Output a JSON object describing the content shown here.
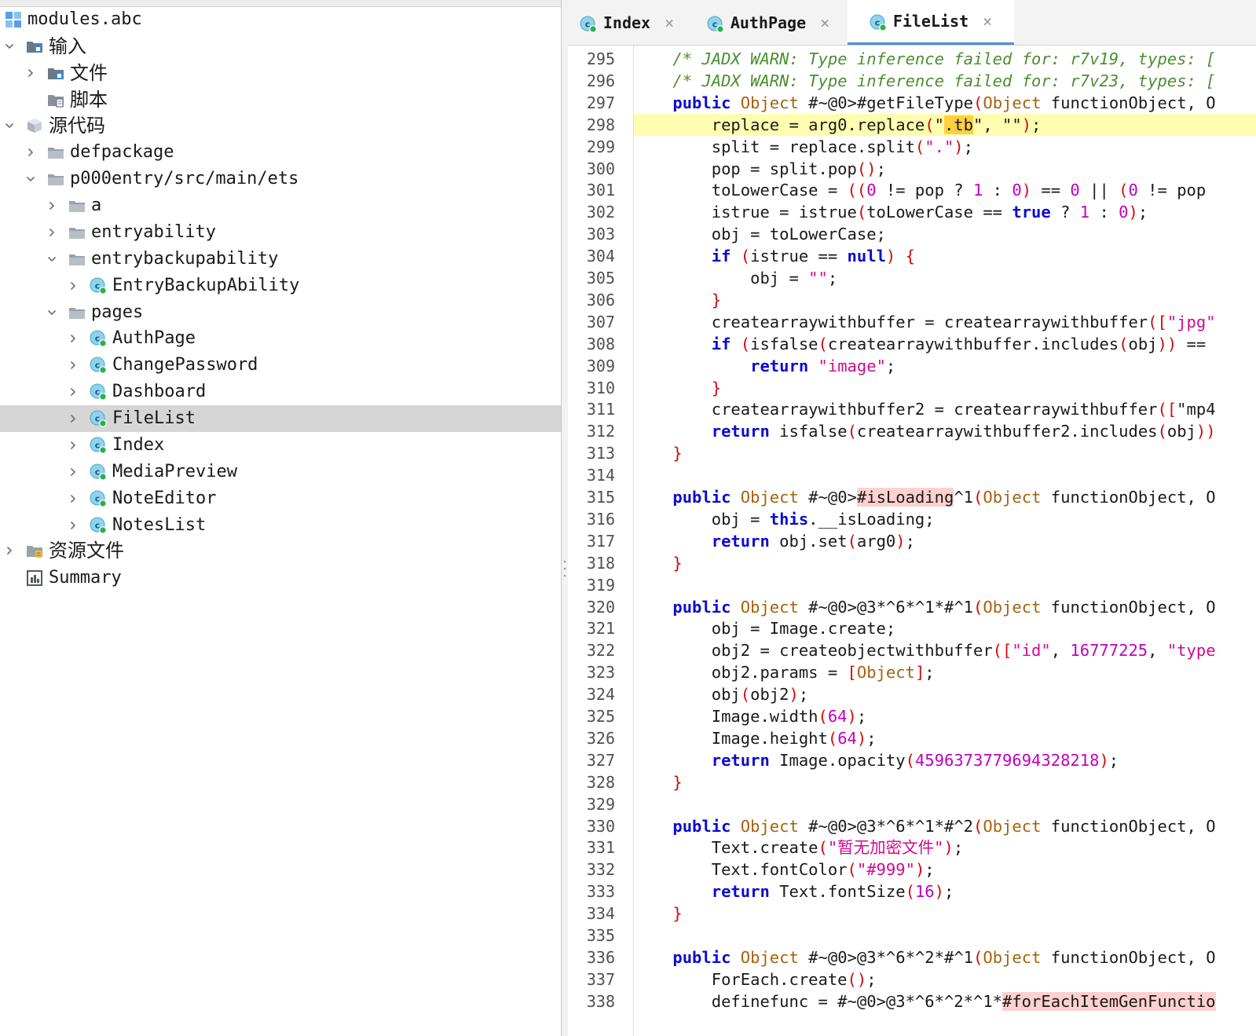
{
  "tree": {
    "items": [
      {
        "label": "modules.abc",
        "icon": "modules-icon",
        "level": 0,
        "chevron": "none",
        "cjk": false
      },
      {
        "label": "输入",
        "icon": "input-folder-icon",
        "level": 0,
        "chevron": "down",
        "cjk": true
      },
      {
        "label": "文件",
        "icon": "input-folder-icon",
        "level": 1,
        "chevron": "right",
        "cjk": true
      },
      {
        "label": "脚本",
        "icon": "script-folder-icon",
        "level": 1,
        "chevron": "none",
        "cjk": true
      },
      {
        "label": "源代码",
        "icon": "package-icon",
        "level": 0,
        "chevron": "down",
        "cjk": true
      },
      {
        "label": "defpackage",
        "icon": "folder-icon",
        "level": 1,
        "chevron": "right",
        "cjk": false
      },
      {
        "label": "p000entry/src/main/ets",
        "icon": "folder-icon",
        "level": 1,
        "chevron": "down",
        "cjk": false
      },
      {
        "label": "a",
        "icon": "folder-icon",
        "level": 2,
        "chevron": "right",
        "cjk": false
      },
      {
        "label": "entryability",
        "icon": "folder-icon",
        "level": 2,
        "chevron": "right",
        "cjk": false
      },
      {
        "label": "entrybackupability",
        "icon": "folder-icon",
        "level": 2,
        "chevron": "down",
        "cjk": false
      },
      {
        "label": "EntryBackupAbility",
        "icon": "class-icon",
        "level": 3,
        "chevron": "right",
        "cjk": false
      },
      {
        "label": "pages",
        "icon": "folder-icon",
        "level": 2,
        "chevron": "down",
        "cjk": false
      },
      {
        "label": "AuthPage",
        "icon": "class-icon",
        "level": 3,
        "chevron": "right",
        "cjk": false
      },
      {
        "label": "ChangePassword",
        "icon": "class-icon",
        "level": 3,
        "chevron": "right",
        "cjk": false
      },
      {
        "label": "Dashboard",
        "icon": "class-icon",
        "level": 3,
        "chevron": "right",
        "cjk": false
      },
      {
        "label": "FileList",
        "icon": "class-icon",
        "level": 3,
        "chevron": "right",
        "cjk": false,
        "selected": true
      },
      {
        "label": "Index",
        "icon": "class-icon",
        "level": 3,
        "chevron": "right",
        "cjk": false
      },
      {
        "label": "MediaPreview",
        "icon": "class-icon",
        "level": 3,
        "chevron": "right",
        "cjk": false
      },
      {
        "label": "NoteEditor",
        "icon": "class-icon",
        "level": 3,
        "chevron": "right",
        "cjk": false
      },
      {
        "label": "NotesList",
        "icon": "class-icon",
        "level": 3,
        "chevron": "right",
        "cjk": false
      },
      {
        "label": "资源文件",
        "icon": "resources-folder-icon",
        "level": 0,
        "chevron": "right",
        "cjk": true
      },
      {
        "label": "Summary",
        "icon": "summary-icon",
        "level": 0,
        "chevron": "none",
        "cjk": false
      }
    ]
  },
  "tabs": [
    {
      "label": "Index",
      "active": false
    },
    {
      "label": "AuthPage",
      "active": false
    },
    {
      "label": "FileList",
      "active": true
    }
  ],
  "tab_close_glyph": "×",
  "editor": {
    "highlight_line": 298,
    "lines": [
      {
        "n": 295,
        "tokens": [
          [
            "    ",
            ""
          ],
          [
            "/* JADX WARN: Type inference failed for: r7v19, types: [",
            ""
          ]
        ],
        "comment": true
      },
      {
        "n": 296,
        "tokens": [
          [
            "    ",
            ""
          ],
          [
            "/* JADX WARN: Type inference failed for: r7v23, types: [",
            ""
          ]
        ],
        "comment": true
      },
      {
        "n": 297,
        "tokens": [
          [
            "    ",
            ""
          ],
          [
            "public",
            "k"
          ],
          [
            " ",
            ""
          ],
          [
            "Object",
            "t"
          ],
          [
            " #~@0>#getFileType",
            ""
          ],
          [
            "(",
            "p"
          ],
          [
            "Object",
            "t"
          ],
          [
            " functionObject, O",
            ""
          ]
        ]
      },
      {
        "n": 298,
        "tokens": [
          [
            "        replace = arg0.replace",
            ""
          ],
          [
            "(",
            "p"
          ],
          [
            "\"",
            ""
          ],
          [
            ".tb",
            "hy"
          ],
          [
            "\"",
            ""
          ],
          [
            ", \"\"",
            ""
          ],
          [
            ")",
            "p"
          ],
          [
            ";",
            ""
          ]
        ]
      },
      {
        "n": 299,
        "tokens": [
          [
            "        split = replace.split",
            ""
          ],
          [
            "(",
            "p"
          ],
          [
            "\".\"",
            "s"
          ],
          [
            ")",
            "p"
          ],
          [
            ";",
            ""
          ]
        ]
      },
      {
        "n": 300,
        "tokens": [
          [
            "        pop = split.pop",
            ""
          ],
          [
            "()",
            "p"
          ],
          [
            ";",
            ""
          ]
        ]
      },
      {
        "n": 301,
        "tokens": [
          [
            "        toLowerCase = ",
            ""
          ],
          [
            "((",
            "p"
          ],
          [
            "0",
            "n"
          ],
          [
            " != pop ? ",
            ""
          ],
          [
            "1",
            "n"
          ],
          [
            " : ",
            ""
          ],
          [
            "0",
            "n"
          ],
          [
            ")",
            "p"
          ],
          [
            " == ",
            ""
          ],
          [
            "0",
            "n"
          ],
          [
            " || ",
            ""
          ],
          [
            "(",
            "p"
          ],
          [
            "0",
            "n"
          ],
          [
            " != pop",
            ""
          ]
        ]
      },
      {
        "n": 302,
        "tokens": [
          [
            "        istrue = istrue",
            ""
          ],
          [
            "(",
            "p"
          ],
          [
            "toLowerCase == ",
            ""
          ],
          [
            "true",
            "k"
          ],
          [
            " ? ",
            ""
          ],
          [
            "1",
            "n"
          ],
          [
            " : ",
            ""
          ],
          [
            "0",
            "n"
          ],
          [
            ")",
            "p"
          ],
          [
            ";",
            ""
          ]
        ]
      },
      {
        "n": 303,
        "tokens": [
          [
            "        obj = toLowerCase;",
            ""
          ]
        ]
      },
      {
        "n": 304,
        "tokens": [
          [
            "        ",
            ""
          ],
          [
            "if",
            "k"
          ],
          [
            " ",
            ""
          ],
          [
            "(",
            "p"
          ],
          [
            "istrue == ",
            ""
          ],
          [
            "null",
            "k"
          ],
          [
            ")",
            "p"
          ],
          [
            " ",
            ""
          ],
          [
            "{",
            "p"
          ]
        ]
      },
      {
        "n": 305,
        "tokens": [
          [
            "            obj = ",
            ""
          ],
          [
            "\"\"",
            "s"
          ],
          [
            ";",
            ""
          ]
        ]
      },
      {
        "n": 306,
        "tokens": [
          [
            "        ",
            ""
          ],
          [
            "}",
            "p"
          ]
        ]
      },
      {
        "n": 307,
        "tokens": [
          [
            "        createarraywithbuffer = createarraywithbuffer",
            ""
          ],
          [
            "([",
            "p"
          ],
          [
            "\"jpg\"",
            "s"
          ]
        ]
      },
      {
        "n": 308,
        "tokens": [
          [
            "        ",
            ""
          ],
          [
            "if",
            "k"
          ],
          [
            " ",
            ""
          ],
          [
            "(",
            "p"
          ],
          [
            "isfalse",
            ""
          ],
          [
            "(",
            "p"
          ],
          [
            "createarraywithbuffer.includes",
            ""
          ],
          [
            "(",
            "p"
          ],
          [
            "obj",
            ""
          ],
          [
            "))",
            "p"
          ],
          [
            " ==",
            ""
          ]
        ]
      },
      {
        "n": 309,
        "tokens": [
          [
            "            ",
            ""
          ],
          [
            "return",
            "k"
          ],
          [
            " ",
            ""
          ],
          [
            "\"image\"",
            "s"
          ],
          [
            ";",
            ""
          ]
        ]
      },
      {
        "n": 310,
        "tokens": [
          [
            "        ",
            ""
          ],
          [
            "}",
            "p"
          ]
        ]
      },
      {
        "n": 311,
        "tokens": [
          [
            "        createarraywithbuffer2 = createarraywithbuffer",
            ""
          ],
          [
            "([",
            "p"
          ],
          [
            "\"mp4",
            ""
          ]
        ]
      },
      {
        "n": 312,
        "tokens": [
          [
            "        ",
            ""
          ],
          [
            "return",
            "k"
          ],
          [
            " isfalse",
            ""
          ],
          [
            "(",
            "p"
          ],
          [
            "createarraywithbuffer2.includes",
            ""
          ],
          [
            "(",
            "p"
          ],
          [
            "obj",
            ""
          ],
          [
            "))",
            "p"
          ]
        ]
      },
      {
        "n": 313,
        "tokens": [
          [
            "    ",
            ""
          ],
          [
            "}",
            "p"
          ]
        ]
      },
      {
        "n": 314,
        "tokens": [
          [
            "",
            ""
          ]
        ]
      },
      {
        "n": 315,
        "tokens": [
          [
            "    ",
            ""
          ],
          [
            "public",
            "k"
          ],
          [
            " ",
            ""
          ],
          [
            "Object",
            "t"
          ],
          [
            " #~@0>",
            ""
          ],
          [
            "#isLoading",
            "hp"
          ],
          [
            "^1",
            ""
          ],
          [
            "(",
            "p"
          ],
          [
            "Object",
            "t"
          ],
          [
            " functionObject, O",
            ""
          ]
        ]
      },
      {
        "n": 316,
        "tokens": [
          [
            "        obj = ",
            ""
          ],
          [
            "this",
            "k"
          ],
          [
            ".__isLoading;",
            ""
          ]
        ]
      },
      {
        "n": 317,
        "tokens": [
          [
            "        ",
            ""
          ],
          [
            "return",
            "k"
          ],
          [
            " obj.set",
            ""
          ],
          [
            "(",
            "p"
          ],
          [
            "arg0",
            ""
          ],
          [
            ")",
            "p"
          ],
          [
            ";",
            ""
          ]
        ]
      },
      {
        "n": 318,
        "tokens": [
          [
            "    ",
            ""
          ],
          [
            "}",
            "p"
          ]
        ]
      },
      {
        "n": 319,
        "tokens": [
          [
            "",
            ""
          ]
        ]
      },
      {
        "n": 320,
        "tokens": [
          [
            "    ",
            ""
          ],
          [
            "public",
            "k"
          ],
          [
            " ",
            ""
          ],
          [
            "Object",
            "t"
          ],
          [
            " #~@0>@3*^6*^1*#^1",
            ""
          ],
          [
            "(",
            "p"
          ],
          [
            "Object",
            "t"
          ],
          [
            " functionObject, O",
            ""
          ]
        ]
      },
      {
        "n": 321,
        "tokens": [
          [
            "        obj = Image.create;",
            ""
          ]
        ]
      },
      {
        "n": 322,
        "tokens": [
          [
            "        obj2 = createobjectwithbuffer",
            ""
          ],
          [
            "([",
            "p"
          ],
          [
            "\"id\"",
            "s"
          ],
          [
            ", ",
            ""
          ],
          [
            "16777225",
            "n"
          ],
          [
            ", ",
            ""
          ],
          [
            "\"type",
            "s"
          ]
        ]
      },
      {
        "n": 323,
        "tokens": [
          [
            "        obj2.params = ",
            ""
          ],
          [
            "[",
            "p"
          ],
          [
            "Object",
            "t"
          ],
          [
            "]",
            "p"
          ],
          [
            ";",
            ""
          ]
        ]
      },
      {
        "n": 324,
        "tokens": [
          [
            "        obj",
            ""
          ],
          [
            "(",
            "p"
          ],
          [
            "obj2",
            ""
          ],
          [
            ")",
            "p"
          ],
          [
            ";",
            ""
          ]
        ]
      },
      {
        "n": 325,
        "tokens": [
          [
            "        Image.width",
            ""
          ],
          [
            "(",
            "p"
          ],
          [
            "64",
            "n"
          ],
          [
            ")",
            "p"
          ],
          [
            ";",
            ""
          ]
        ]
      },
      {
        "n": 326,
        "tokens": [
          [
            "        Image.height",
            ""
          ],
          [
            "(",
            "p"
          ],
          [
            "64",
            "n"
          ],
          [
            ")",
            "p"
          ],
          [
            ";",
            ""
          ]
        ]
      },
      {
        "n": 327,
        "tokens": [
          [
            "        ",
            ""
          ],
          [
            "return",
            "k"
          ],
          [
            " Image.opacity",
            ""
          ],
          [
            "(",
            "p"
          ],
          [
            "4596373779694328218",
            "n"
          ],
          [
            ")",
            "p"
          ],
          [
            ";",
            ""
          ]
        ]
      },
      {
        "n": 328,
        "tokens": [
          [
            "    ",
            ""
          ],
          [
            "}",
            "p"
          ]
        ]
      },
      {
        "n": 329,
        "tokens": [
          [
            "",
            ""
          ]
        ]
      },
      {
        "n": 330,
        "tokens": [
          [
            "    ",
            ""
          ],
          [
            "public",
            "k"
          ],
          [
            " ",
            ""
          ],
          [
            "Object",
            "t"
          ],
          [
            " #~@0>@3*^6*^1*#^2",
            ""
          ],
          [
            "(",
            "p"
          ],
          [
            "Object",
            "t"
          ],
          [
            " functionObject, O",
            ""
          ]
        ]
      },
      {
        "n": 331,
        "tokens": [
          [
            "        Text.create",
            ""
          ],
          [
            "(",
            "p"
          ],
          [
            "\"暂无加密文件\"",
            "s"
          ],
          [
            ")",
            "p"
          ],
          [
            ";",
            ""
          ]
        ]
      },
      {
        "n": 332,
        "tokens": [
          [
            "        Text.fontColor",
            ""
          ],
          [
            "(",
            "p"
          ],
          [
            "\"#999\"",
            "s"
          ],
          [
            ")",
            "p"
          ],
          [
            ";",
            ""
          ]
        ]
      },
      {
        "n": 333,
        "tokens": [
          [
            "        ",
            ""
          ],
          [
            "return",
            "k"
          ],
          [
            " Text.fontSize",
            ""
          ],
          [
            "(",
            "p"
          ],
          [
            "16",
            "n"
          ],
          [
            ")",
            "p"
          ],
          [
            ";",
            ""
          ]
        ]
      },
      {
        "n": 334,
        "tokens": [
          [
            "    ",
            ""
          ],
          [
            "}",
            "p"
          ]
        ]
      },
      {
        "n": 335,
        "tokens": [
          [
            "",
            ""
          ]
        ]
      },
      {
        "n": 336,
        "tokens": [
          [
            "    ",
            ""
          ],
          [
            "public",
            "k"
          ],
          [
            " ",
            ""
          ],
          [
            "Object",
            "t"
          ],
          [
            " #~@0>@3*^6*^2*#^1",
            ""
          ],
          [
            "(",
            "p"
          ],
          [
            "Object",
            "t"
          ],
          [
            " functionObject, O",
            ""
          ]
        ]
      },
      {
        "n": 337,
        "tokens": [
          [
            "        ForEach.create",
            ""
          ],
          [
            "()",
            "p"
          ],
          [
            ";",
            ""
          ]
        ]
      },
      {
        "n": 338,
        "tokens": [
          [
            "        definefunc = #~@0>@3*^6*^2*^1*",
            ""
          ],
          [
            "#forEachItemGenFunctio",
            "hp"
          ]
        ]
      }
    ]
  }
}
